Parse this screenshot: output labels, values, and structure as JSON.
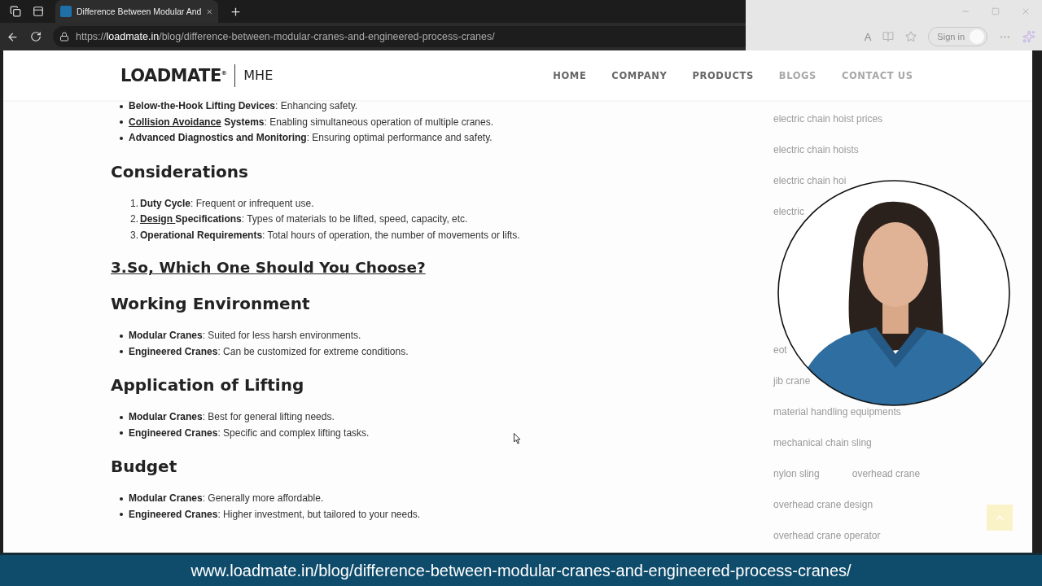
{
  "browser": {
    "tabs": [
      {
        "title": "Difference Between Modular And",
        "selected": true
      }
    ],
    "url": {
      "scheme": "https://",
      "host": "loadmate.in",
      "path": "/blog/difference-between-modular-cranes-and-engineered-process-cranes/"
    },
    "sign_in": "Sign in",
    "read_aloud": "A"
  },
  "site": {
    "logo": "LOADMATE",
    "logo_mark": "®",
    "logo_suffix": "MHE",
    "nav": [
      {
        "label": "HOME",
        "faded": false
      },
      {
        "label": "COMPANY",
        "faded": false
      },
      {
        "label": "PRODUCTS",
        "faded": false
      },
      {
        "label": "BLOGS",
        "faded": true
      },
      {
        "label": "CONTACT US",
        "faded": true
      }
    ]
  },
  "article": [
    {
      "kind": "bullets",
      "items": [
        {
          "term": "Below-the-Hook Lifting Devices",
          "desc": ": Enhancing safety."
        },
        {
          "link": "Collision Avoidance",
          "term": " Systems",
          "desc": ": Enabling simultaneous operation of multiple cranes."
        },
        {
          "term": "Advanced Diagnostics and Monitoring",
          "desc": ": Ensuring optimal performance and safety."
        }
      ]
    },
    {
      "kind": "heading",
      "text": "Considerations"
    },
    {
      "kind": "numbered",
      "items": [
        {
          "number": "1.",
          "term": "Duty Cycle",
          "desc": ": Frequent or infrequent use."
        },
        {
          "number": "2.",
          "link": "Design ",
          "term": "Specifications",
          "desc": ": Types of materials to be lifted, speed, capacity, etc."
        },
        {
          "number": "3.",
          "term": "Operational Requirements",
          "desc": ": Total hours of operation, the number of movements or lifts."
        }
      ]
    },
    {
      "kind": "section_link",
      "text": "3.So, Which One Should You Choose?"
    },
    {
      "kind": "heading",
      "text": "Working Environment"
    },
    {
      "kind": "bullets",
      "items": [
        {
          "term": "Modular Cranes",
          "desc": ": Suited for less harsh environments."
        },
        {
          "term": "Engineered Cranes",
          "desc": ": Can be customized for extreme conditions."
        }
      ]
    },
    {
      "kind": "heading",
      "text": "Application of Lifting"
    },
    {
      "kind": "bullets",
      "items": [
        {
          "term": "Modular Cranes",
          "desc": ": Best for general lifting needs."
        },
        {
          "term": "Engineered Cranes",
          "desc": ": Specific and complex lifting tasks."
        }
      ]
    },
    {
      "kind": "heading",
      "text": "Budget"
    },
    {
      "kind": "bullets",
      "items": [
        {
          "term": "Modular Cranes",
          "desc": ": Generally more affordable."
        },
        {
          "term": "Engineered Cranes",
          "desc": ": Higher investment, but tailored to your needs."
        }
      ]
    }
  ],
  "sidebar": {
    "tag_rows_upper": [
      [
        "electric chain hoist prices"
      ],
      [
        "electric chain hoists"
      ],
      [
        "electric chain hoi"
      ],
      [
        "electric"
      ]
    ],
    "tag_rows_lower": [
      [
        "eot"
      ],
      [
        "jib crane"
      ],
      [
        "material handling equipments"
      ],
      [
        "mechanical chain sling"
      ],
      [
        "nylon sling",
        "overhead crane"
      ],
      [
        "overhead crane design"
      ],
      [
        "overhead crane operator"
      ]
    ]
  },
  "caption": "www.loadmate.in/blog/difference-between-modular-cranes-and-engineered-process-cranes/"
}
